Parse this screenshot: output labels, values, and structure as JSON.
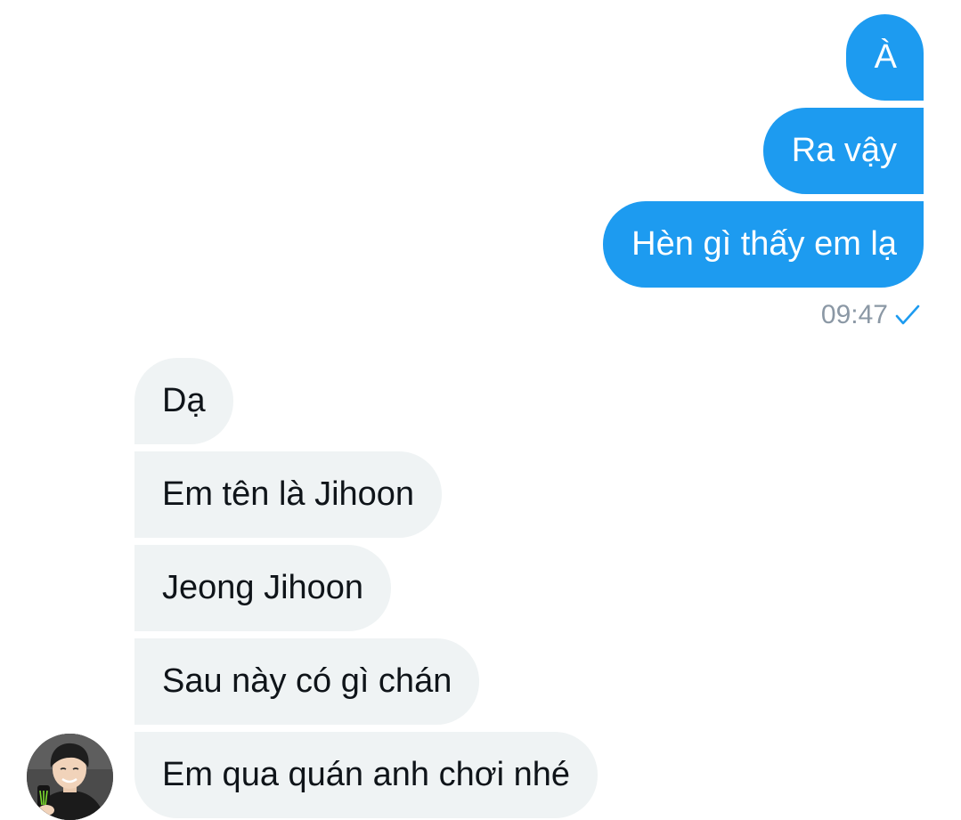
{
  "conversation": {
    "outgoing": [
      {
        "text": "À"
      },
      {
        "text": "Ra vậy"
      },
      {
        "text": "Hèn gì thấy em lạ"
      }
    ],
    "outgoing_time": "09:47",
    "outgoing_status_icon": "check-icon",
    "incoming": [
      {
        "text": "Dạ"
      },
      {
        "text": "Em tên là Jihoon"
      },
      {
        "text": "Jeong Jihoon"
      },
      {
        "text": "Sau này có gì chán"
      },
      {
        "text": "Em qua quán anh chơi nhé"
      }
    ]
  },
  "colors": {
    "outgoing_bubble": "#1d9bf0",
    "incoming_bubble": "#eff3f4",
    "timestamp": "#8b98a5",
    "check": "#1d9bf0"
  }
}
